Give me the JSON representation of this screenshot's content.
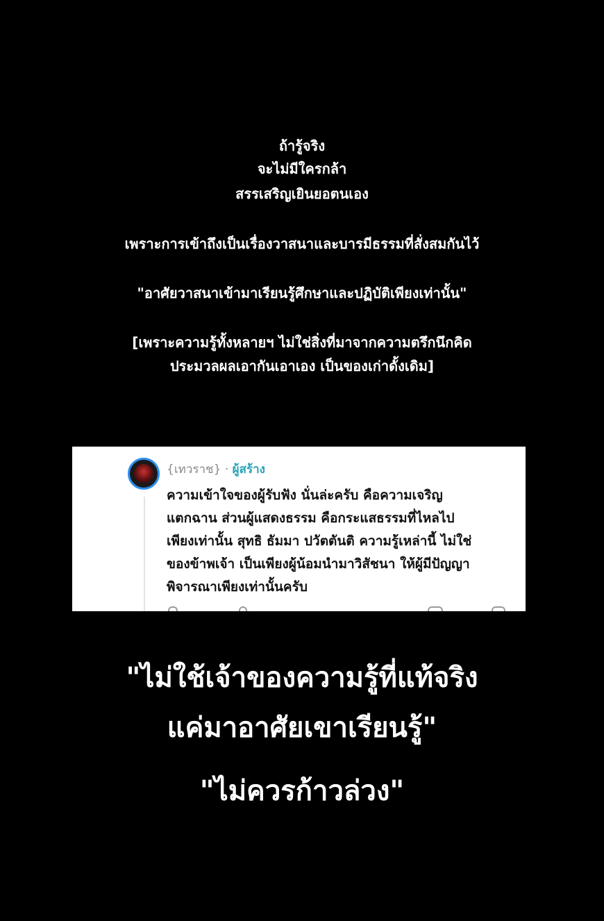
{
  "intro": {
    "line1": "ถ้ารู้จริง",
    "line2": "จะไม่มีใครกล้า",
    "line3": "สรรเสริญเยินยอตนเอง",
    "line4": "เพราะการเข้าถึงเป็นเรื่องวาสนาและบารมีธรรมที่สั่งสมกันไว้",
    "line5": "\"อาศัยวาสนาเข้ามาเรียนรู้ศึกษาและปฏิบัติเพียงเท่านั้น\"",
    "line6": "[เพราะความรู้ทั้งหลายฯ ไม่ใช่สิ่งที่มาจากความตรึกนึกคิด",
    "line7": "ประมวลผลเอากันเอาเอง เป็นของเก่าดั้งเดิม]"
  },
  "comment": {
    "author": "{เทวราช}",
    "separator": "·",
    "badge": "ผู้สร้าง",
    "lines": [
      "ความเข้าใจของผู้รับฟัง นั่นล่ะครับ คือความเจริญ",
      "แตกฉาน ส่วนผู้แสดงธรรม คือกระแสธรรมที่ไหลไป",
      "เพียงเท่านั้น สุทธิ ธัมมา ปวัตตันติ ความรู้เหล่านี้ ไม่ใช่",
      "ของข้าพเจ้า เป็นเพียงผู้น้อมนำมาวิสัชนา ให้ผู้มีปัญญา",
      "พิจารณาเพียงเท่านั้นครับ"
    ],
    "avatar_icon": "user-avatar",
    "colors": {
      "badge": "#2aa3b8",
      "avatar_ring": "#2f8ef0",
      "author": "#8a8a8a"
    }
  },
  "closing": {
    "quote_line1": "\"ไม่ใช้เจ้าของความรู้ที่แท้จริง",
    "quote_line2": "แค่มาอาศัยเขาเรียนรู้\"",
    "quote_line3": "\"ไม่ควรก้าวล่วง\""
  }
}
